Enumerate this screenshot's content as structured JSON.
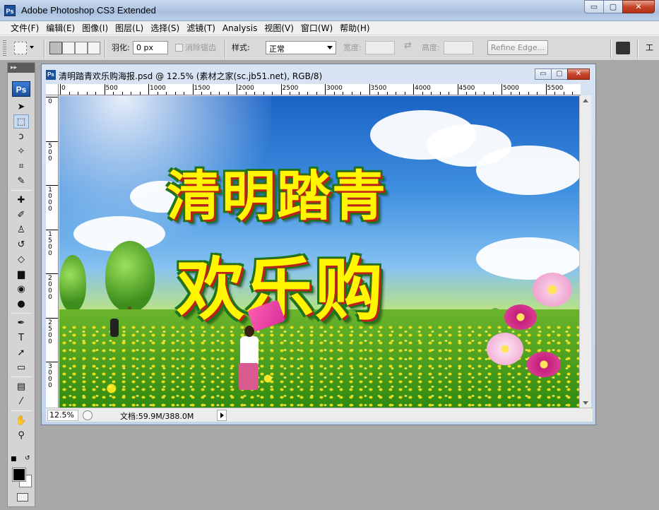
{
  "window": {
    "app_title": "Adobe Photoshop CS3 Extended",
    "logo_text": "Ps",
    "min_label": "▭",
    "max_label": "▢",
    "close_label": "✕"
  },
  "menu": [
    {
      "label": "文件(F)"
    },
    {
      "label": "编辑(E)"
    },
    {
      "label": "图像(I)"
    },
    {
      "label": "图层(L)"
    },
    {
      "label": "选择(S)"
    },
    {
      "label": "滤镜(T)"
    },
    {
      "label": "Analysis"
    },
    {
      "label": "视图(V)"
    },
    {
      "label": "窗口(W)"
    },
    {
      "label": "帮助(H)"
    }
  ],
  "options": {
    "feather_label": "羽化:",
    "feather_value": "0 px",
    "antialias_label": "消除锯齿",
    "style_label": "样式:",
    "style_value": "正常",
    "width_label": "宽度:",
    "height_label": "高度:",
    "swap_symbol": "⇄",
    "refine_edge": "Refine Edge...",
    "workspace_label": "工"
  },
  "toolbox": {
    "header": "▸▸",
    "logo": "Ps",
    "tools": [
      {
        "name": "move-tool",
        "glyph": "➤",
        "icon": "move-icon"
      },
      {
        "name": "marquee-tool",
        "glyph": "⬚",
        "icon": "marquee-icon"
      },
      {
        "name": "lasso-tool",
        "glyph": "ↄ",
        "icon": "lasso-icon"
      },
      {
        "name": "magic-wand-tool",
        "glyph": "✧",
        "icon": "magic-wand-icon"
      },
      {
        "name": "crop-tool",
        "glyph": "⌗",
        "icon": "crop-icon"
      },
      {
        "name": "slice-tool",
        "glyph": "✎",
        "icon": "slice-icon"
      },
      {
        "name": "healing-tool",
        "glyph": "✚",
        "icon": "healing-icon"
      },
      {
        "name": "brush-tool",
        "glyph": "✐",
        "icon": "brush-icon"
      },
      {
        "name": "stamp-tool",
        "glyph": "♙",
        "icon": "stamp-icon"
      },
      {
        "name": "history-brush-tool",
        "glyph": "↺",
        "icon": "history-brush-icon"
      },
      {
        "name": "eraser-tool",
        "glyph": "◇",
        "icon": "eraser-icon"
      },
      {
        "name": "gradient-tool",
        "glyph": "▆",
        "icon": "gradient-icon"
      },
      {
        "name": "blur-tool",
        "glyph": "◉",
        "icon": "blur-icon"
      },
      {
        "name": "dodge-tool",
        "glyph": "●",
        "icon": "dodge-icon"
      },
      {
        "name": "pen-tool",
        "glyph": "✒",
        "icon": "pen-icon"
      },
      {
        "name": "type-tool",
        "glyph": "T",
        "icon": "type-icon"
      },
      {
        "name": "path-select-tool",
        "glyph": "➚",
        "icon": "path-select-icon"
      },
      {
        "name": "shape-tool",
        "glyph": "▭",
        "icon": "shape-icon"
      },
      {
        "name": "notes-tool",
        "glyph": "▤",
        "icon": "notes-icon"
      },
      {
        "name": "eyedropper-tool",
        "glyph": "⁄",
        "icon": "eyedropper-icon"
      },
      {
        "name": "hand-tool",
        "glyph": "✋",
        "icon": "hand-icon"
      },
      {
        "name": "zoom-tool",
        "glyph": "⚲",
        "icon": "zoom-icon"
      }
    ],
    "reset_symbol": "■",
    "swap_symbol": "↺"
  },
  "document": {
    "title": "清明踏青欢乐购海报.psd @ 12.5% (素材之家(sc.jb51.net), RGB/8)",
    "logo": "Ps",
    "ruler_h": [
      "0",
      "500",
      "1000",
      "1500",
      "2000",
      "2500",
      "3000",
      "3500",
      "4000",
      "4500",
      "5000",
      "5500"
    ],
    "ruler_v": [
      "0",
      "500",
      "1000",
      "1500",
      "2000",
      "2500",
      "3000"
    ],
    "zoom": "12.5%",
    "doc_size": "文档:59.9M/388.0M"
  },
  "poster": {
    "line1": "清明踏青",
    "line2": "欢乐购"
  }
}
